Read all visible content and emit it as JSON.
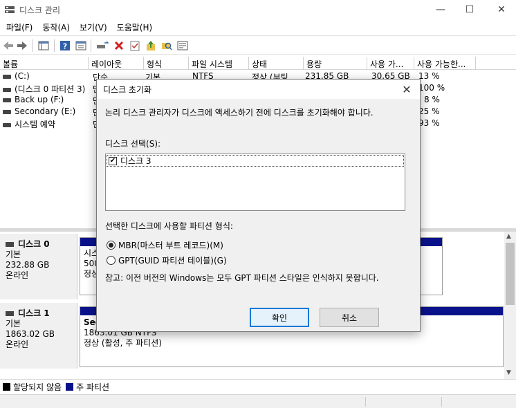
{
  "window": {
    "title": "디스크 관리",
    "minimize": "—",
    "maximize": "☐",
    "close": "✕"
  },
  "menu": [
    "파일(F)",
    "동작(A)",
    "보기(V)",
    "도움말(H)"
  ],
  "volume_table": {
    "columns": [
      "볼륨",
      "레이아웃",
      "형식",
      "파일 시스템",
      "상태",
      "용량",
      "사용 가...",
      "사용 가능한..."
    ],
    "rows": [
      {
        "name": "(C:)",
        "layout": "단순",
        "type": "기본",
        "fs": "NTFS",
        "status": "정상 (부팅...",
        "capacity": "231.85 GB",
        "free": "30.65 GB",
        "pct": "13 %"
      },
      {
        "name": "(디스크 0 파티션 3)",
        "layout": "단",
        "pct": "100 %"
      },
      {
        "name": "Back up (F:)",
        "layout": "단",
        "pct": "8 %"
      },
      {
        "name": "Secondary (E:)",
        "layout": "단",
        "pct": "25 %"
      },
      {
        "name": "시스템 예약",
        "layout": "단",
        "pct": "93 %"
      }
    ]
  },
  "disks": [
    {
      "name": "디스크 0",
      "kind": "기본",
      "size": "232.88 GB",
      "state": "온라인",
      "partition_lines": [
        "시스",
        "500",
        "정상"
      ],
      "right_fragment": ")"
    },
    {
      "name": "디스크 1",
      "kind": "기본",
      "size": "1863.02 GB",
      "state": "온라인",
      "partition_lines": [
        "Sec",
        "1863.01 GB NTFS",
        "정상 (활성, 주 파티션)"
      ]
    }
  ],
  "legend": [
    {
      "label": "할당되지 않음",
      "color": "#000000"
    },
    {
      "label": "주 파티션",
      "color": "#0a128b"
    }
  ],
  "dialog": {
    "title": "디스크 초기화",
    "close": "✕",
    "message": "논리 디스크 관리자가 디스크에 액세스하기 전에 디스크를 초기화해야 합니다.",
    "select_label": "디스크 선택(S):",
    "disk_item": "디스크 3",
    "disk_checked": true,
    "style_label": "선택한 디스크에 사용할 파티션 형식:",
    "options": [
      {
        "label": "MBR(마스터 부트 레코드)(M)",
        "selected": true
      },
      {
        "label": "GPT(GUID 파티션 테이블)(G)",
        "selected": false
      }
    ],
    "note": "참고: 이전 버전의 Windows는 모두 GPT 파티션 스타일은 인식하지 못합니다.",
    "ok_label": "확인",
    "cancel_label": "취소"
  },
  "colors": {
    "primary_partition": "#0a128b",
    "accent": "#0078d7",
    "delete_red": "#d32020"
  }
}
